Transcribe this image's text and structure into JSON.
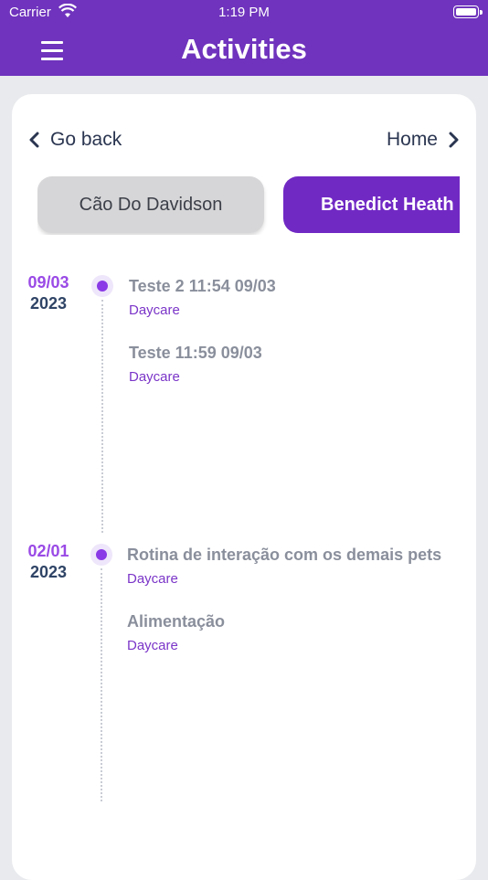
{
  "status": {
    "carrier": "Carrier",
    "time": "1:19 PM"
  },
  "header": {
    "title": "Activities"
  },
  "nav": {
    "back_label": "Go back",
    "home_label": "Home"
  },
  "pets": [
    {
      "name": "Cão Do Davidson",
      "selected": false
    },
    {
      "name": "Benedict Heath",
      "selected": true
    }
  ],
  "timeline": [
    {
      "day": "09/03",
      "year": "2023",
      "activities": [
        {
          "title": "Teste 2 11:54 09/03",
          "category": "Daycare"
        },
        {
          "title": "Teste 11:59 09/03",
          "category": "Daycare"
        }
      ]
    },
    {
      "day": "02/01",
      "year": "2023",
      "activities": [
        {
          "title": "Rotina de interação com os demais pets",
          "category": "Daycare"
        },
        {
          "title": "Alimentação",
          "category": "Daycare"
        }
      ]
    }
  ],
  "colors": {
    "header": "#6f33bd",
    "accent": "#7129c4",
    "date_day": "#9a4ae6",
    "date_year": "#2f4466"
  }
}
